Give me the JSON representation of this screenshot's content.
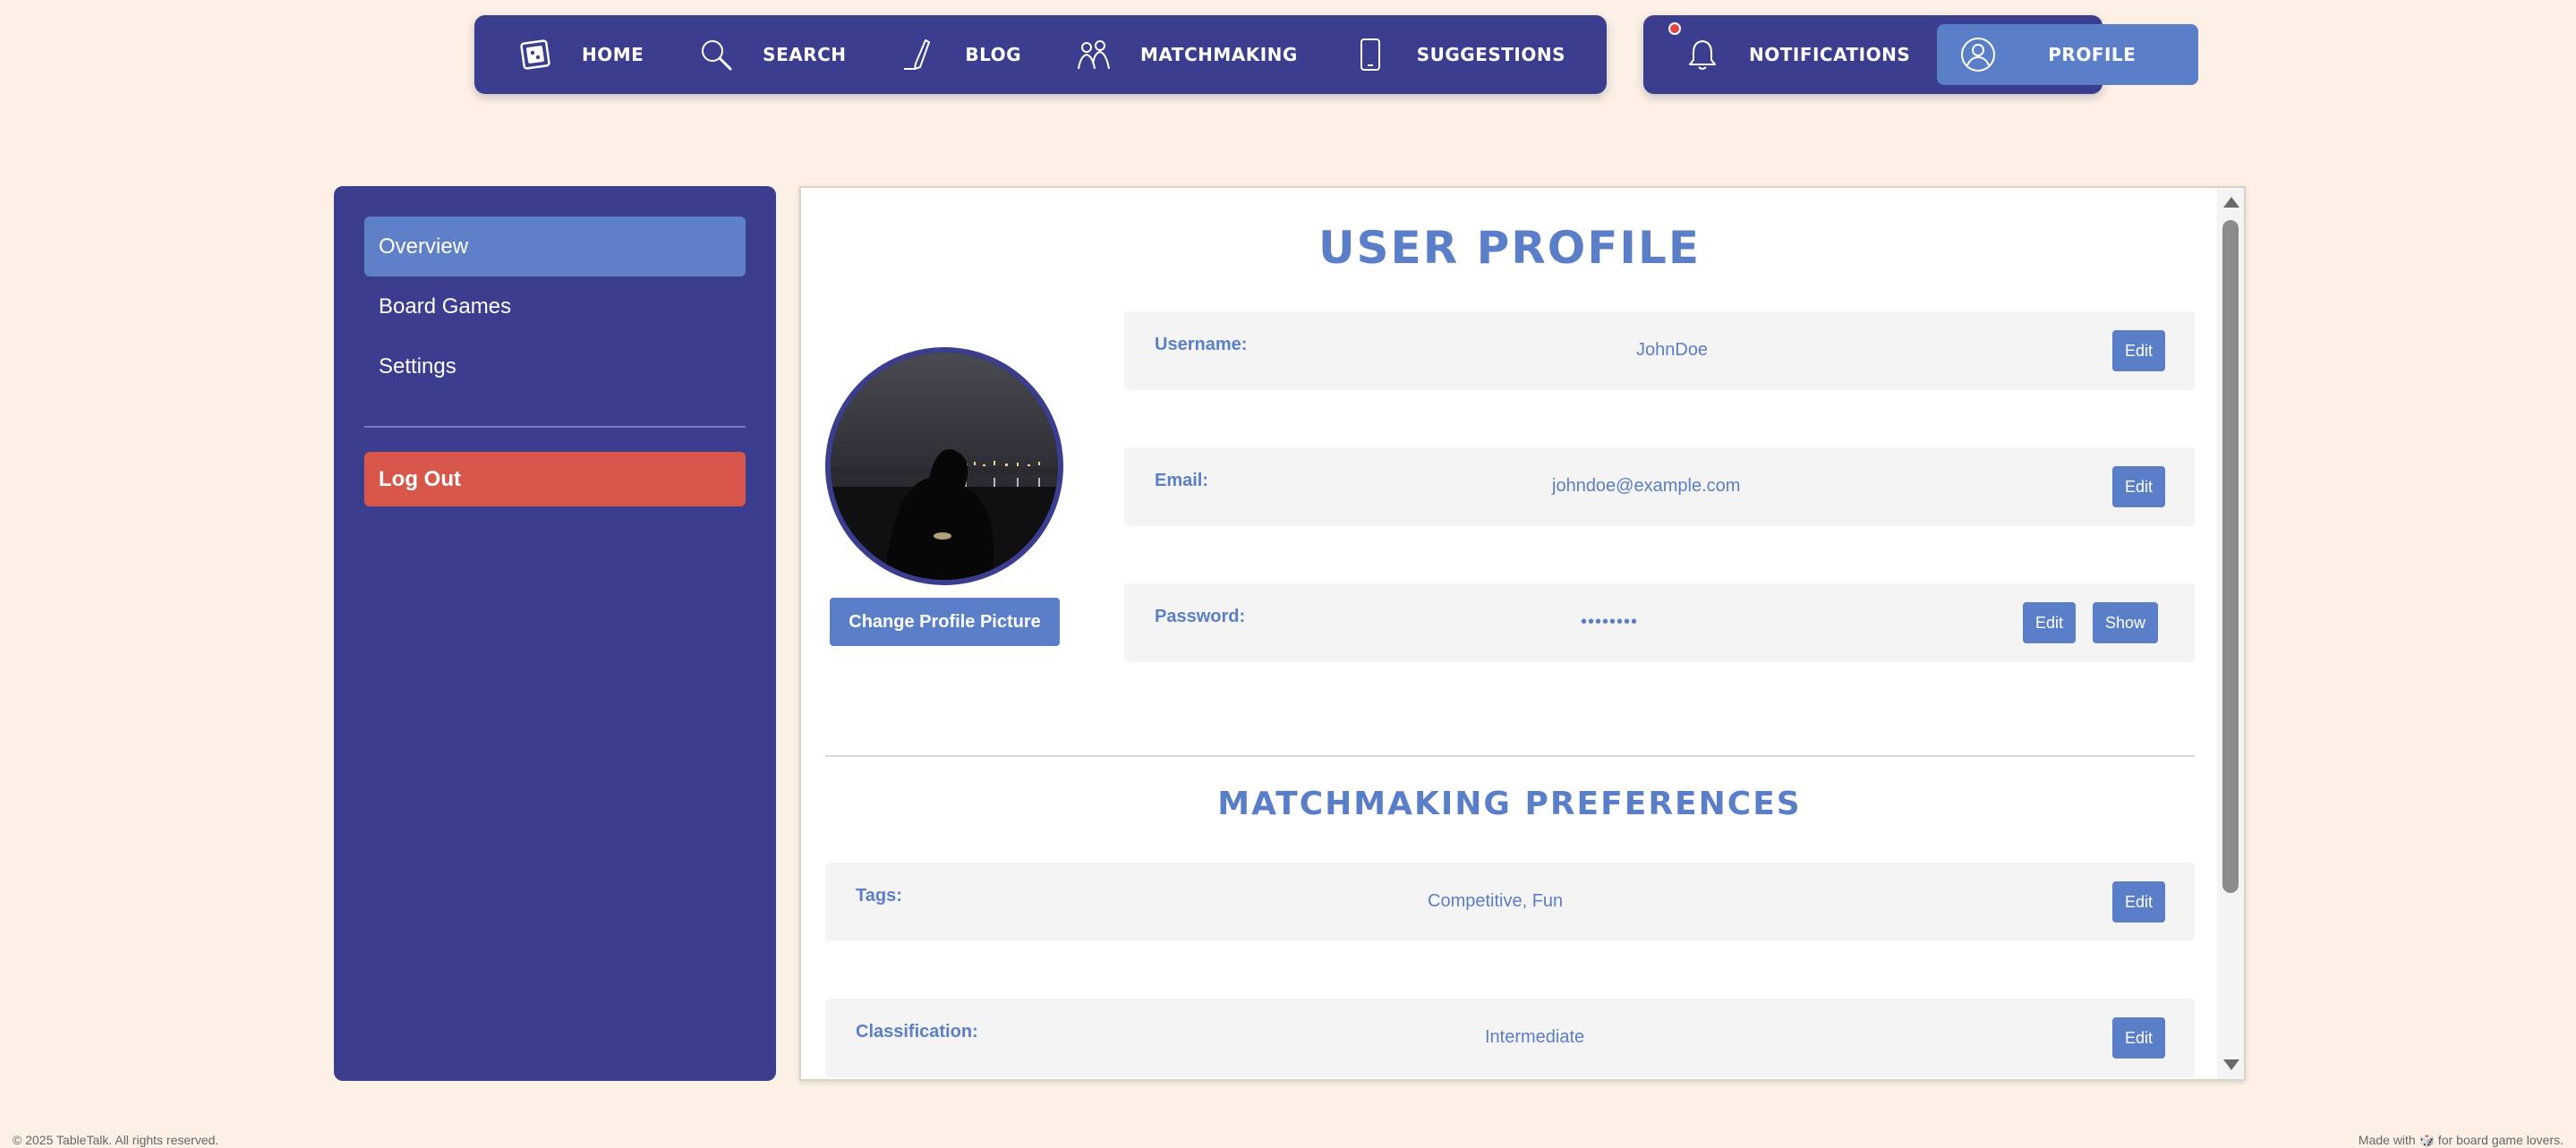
{
  "nav": {
    "items": [
      {
        "label": "HOME",
        "icon": "game-box-icon"
      },
      {
        "label": "SEARCH",
        "icon": "magnifier-icon"
      },
      {
        "label": "BLOG",
        "icon": "pen-icon"
      },
      {
        "label": "MATCHMAKING",
        "icon": "people-icon"
      },
      {
        "label": "SUGGESTIONS",
        "icon": "phone-icon"
      }
    ],
    "notifications_label": "NOTIFICATIONS",
    "profile_label": "PROFILE"
  },
  "sidebar": {
    "items": [
      {
        "label": "Overview",
        "active": true
      },
      {
        "label": "Board Games",
        "active": false
      },
      {
        "label": "Settings",
        "active": false
      }
    ],
    "logout_label": "Log Out"
  },
  "profile": {
    "title": "USER PROFILE",
    "change_picture_label": "Change Profile Picture",
    "fields": [
      {
        "label": "Username:",
        "value": "JohnDoe",
        "edit_label": "Edit"
      },
      {
        "label": "Email:",
        "value": "johndoe@example.com",
        "edit_label": "Edit"
      },
      {
        "label": "Password:",
        "value": "••••••••",
        "edit_label": "Edit",
        "show_label": "Show"
      }
    ]
  },
  "matchmaking": {
    "title": "MATCHMAKING PREFERENCES",
    "fields": [
      {
        "label": "Tags:",
        "value": "Competitive, Fun",
        "edit_label": "Edit"
      },
      {
        "label": "Classification:",
        "value": "Intermediate",
        "edit_label": "Edit"
      }
    ]
  },
  "footer": {
    "left": "© 2025 TableTalk. All rights reserved.",
    "right": "Made with 🎲 for board game lovers."
  },
  "colors": {
    "background": "#fdf1e5",
    "navy": "#3b3d8e",
    "accent_blue": "#5b7ec9",
    "logout_red": "#d9574a",
    "notification_dot": "#e64444"
  }
}
